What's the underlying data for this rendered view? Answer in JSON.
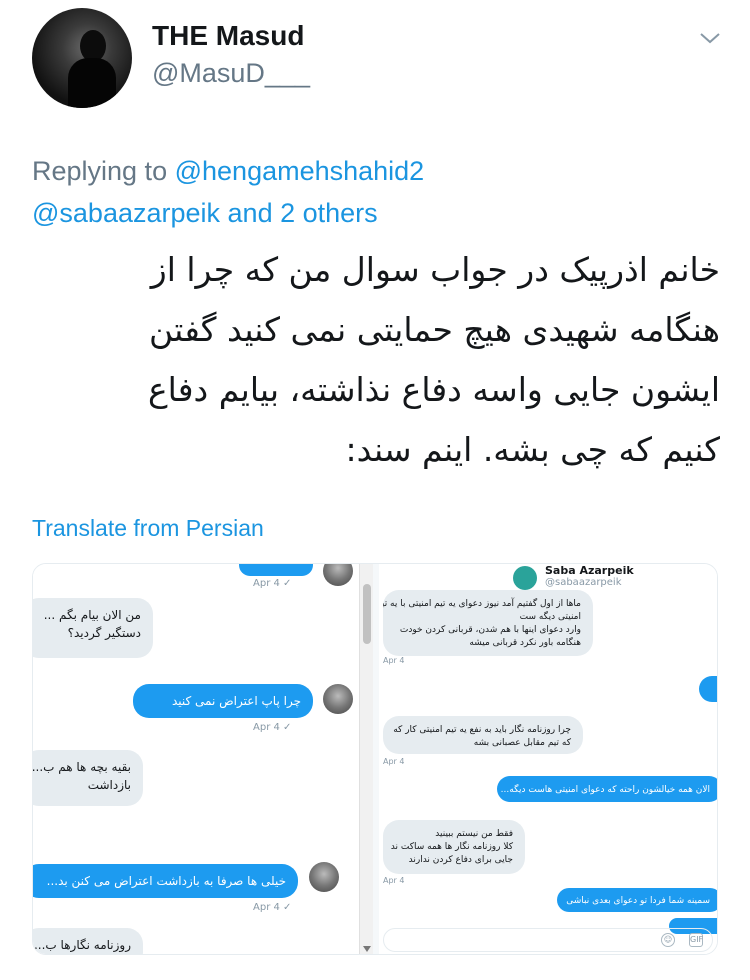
{
  "author": {
    "name": "THE Masud",
    "handle": "@MasuD___"
  },
  "reply": {
    "prefix": "Replying to",
    "mention1": "@hengamehshahid2",
    "mention2": "@sabaazarpeik",
    "others": "and 2 others"
  },
  "tweet": {
    "lines": [
      "خانم اذرپیک در جواب سوال من که چرا از",
      "هنگامه شهیدی هیچ حمایتی نمی کنید گفتن",
      "ایشون جایی واسه دفاع نذاشته، بیایم دفاع",
      "کنیم که چی بشه. اینم سند:"
    ]
  },
  "translate_label": "Translate from Persian",
  "media": {
    "left": {
      "stamps": [
        "Apr 4 ✓",
        "Apr 4 ✓",
        "Apr 4 ✓"
      ],
      "messages": [
        "من الان بیام بگم ...",
        "دستگیر گردید؟",
        "چرا پاپ اعتراض نمی کنید",
        "بقیه بچه ها هم ب...",
        "بازداشت",
        "خیلی ها صرفا به بازداشت اعتراض می کنن بد...",
        "روزنامه نگارها ب..."
      ]
    },
    "right": {
      "profile_name": "Saba Azarpeik",
      "profile_handle": "@sabaazarpeik",
      "stamps": [
        "Apr 4",
        "Apr 4",
        "Apr 4"
      ],
      "messages": [
        "ماها از اول گفتیم آمد نیوز دعوای یه تیم امنیتی با یه تیم",
        "امنیتی دیگه ست",
        "وارد دعوای اینها با هم شدن، قربانی کردن خودت",
        "هنگامه باور نکرد قربانی میشه",
        "چرا روزنامه نگار باید به نفع یه تیم امنیتی کار که",
        "که تیم مقابل عصبانی بشه",
        "الان همه خیالشون راحته که دعوای امنیتی هاست دیگه...",
        "فقط من نیستم ببینید",
        "کلا روزنامه نگار ها همه ساکت ند",
        "جایی برای دفاع کردن ندارند",
        "سمینه شما فردا تو دعوای بعدی نباشی"
      ]
    }
  }
}
